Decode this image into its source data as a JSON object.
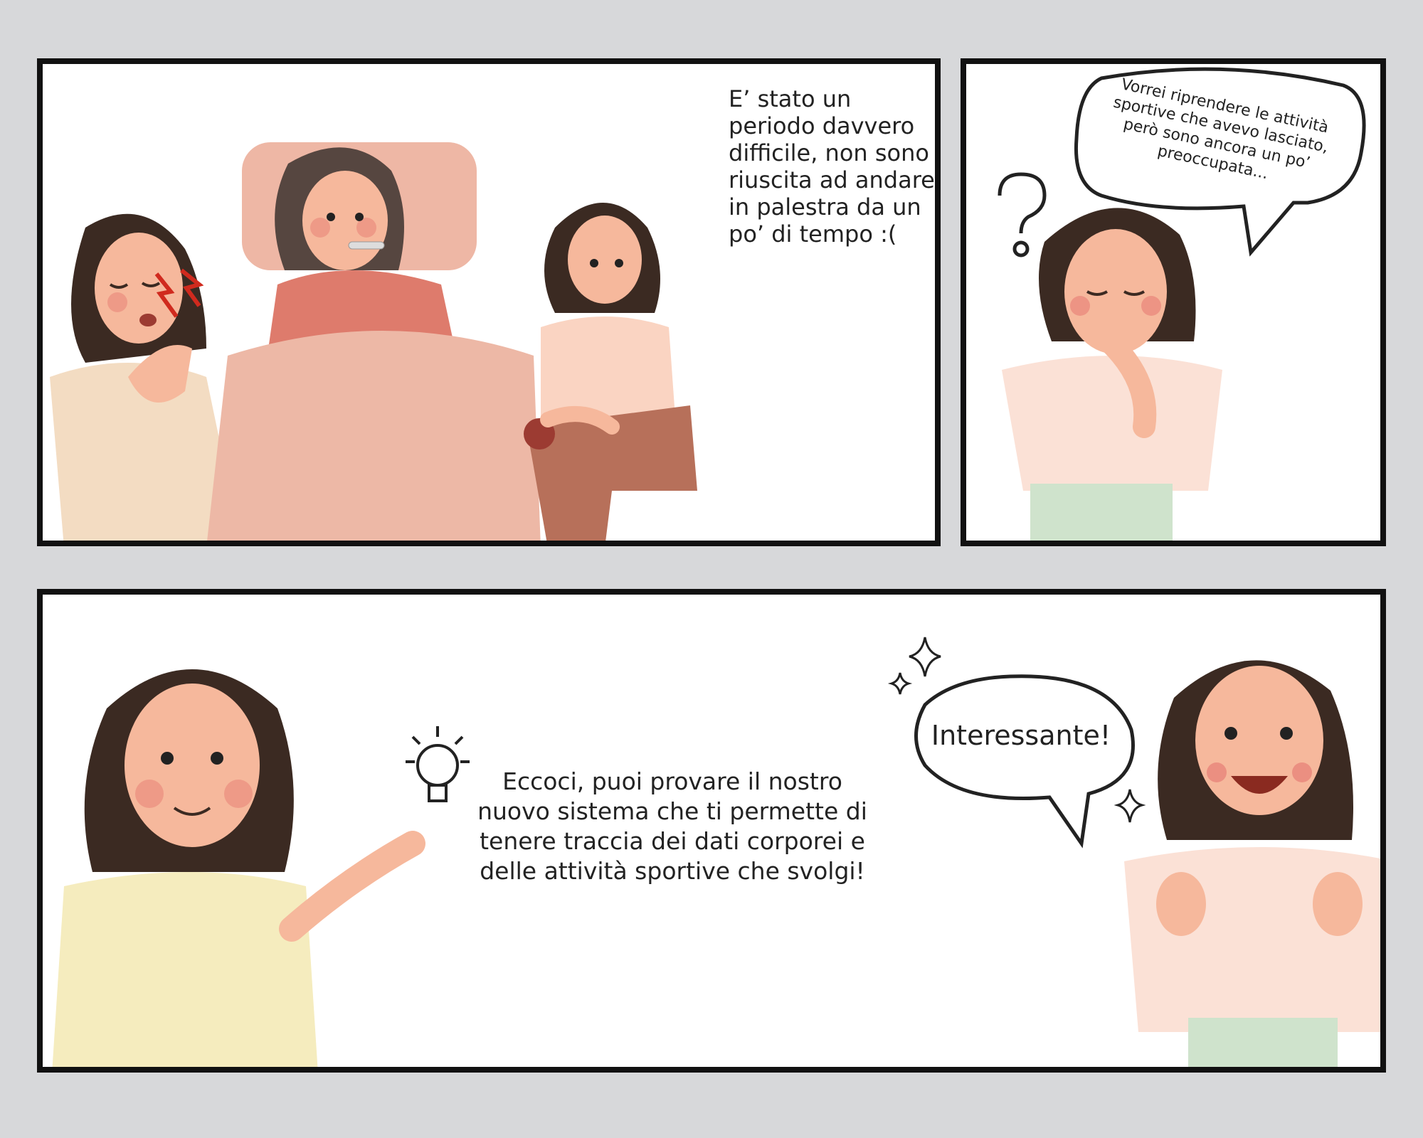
{
  "panel1": {
    "narration": "E’ stato un periodo davvero difficile, non sono riuscita ad andare in palestra da un po’ di tempo :("
  },
  "panel2": {
    "bubble": "Vorrei riprendere le attività sportive che avevo lasciato, però sono ancora un po’ preoccupata..."
  },
  "panel3": {
    "narration": "Eccoci, puoi provare il nostro nuovo sistema che ti permette di tenere traccia dei dati corporei e delle attività sportive che svolgi!",
    "bubble": "Interessante!"
  },
  "colors": {
    "background": "#d7d8da",
    "panel": "#ffffff",
    "border": "#111111",
    "hair": "#3b2a22",
    "skin": "#f6b89c",
    "blush": "#e9857a",
    "pink_shirt": "#f5d3c4",
    "yellow_shirt": "#f5ecbe",
    "green_pants": "#cfe3cc",
    "brown_pants": "#b7705a",
    "pain_red": "#d02a1e"
  },
  "icons": [
    "question-mark-icon",
    "lightbulb-icon",
    "sparkle-icon",
    "pain-bolt-icon"
  ]
}
